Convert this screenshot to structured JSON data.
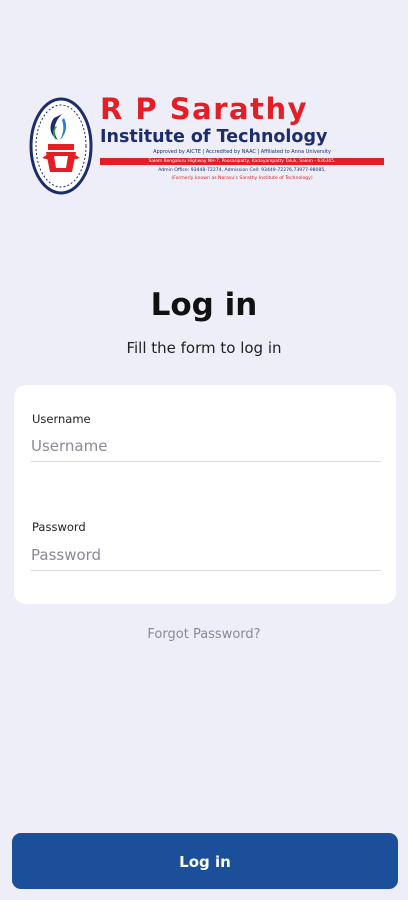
{
  "logo": {
    "name": "R P Sarathy",
    "subtitle": "Institute of Technology",
    "approved": "Approved by AICTE | Accredited by NAAC | Affiliated to Anna University",
    "address": "Salem Bengaluru Highway NH-7, Poosaripatty, Kadayampatty Taluk, Salem - 636305.",
    "contact": "Admin Office: 93448-72274, Admission Cell: 93449-72276,73977-98085,",
    "formerly": "(Formerly known as Narasu's Sarathy Institute of Technology)",
    "colors": {
      "red": "#e31e24",
      "navy": "#1d2d6b"
    }
  },
  "header": {
    "title": "Log in",
    "subtitle": "Fill the form to log in"
  },
  "form": {
    "username": {
      "label": "Username",
      "placeholder": "Username",
      "value": ""
    },
    "password": {
      "label": "Password",
      "placeholder": "Password",
      "value": ""
    }
  },
  "forgot_password": "Forgot Password?",
  "login_button": "Log in",
  "colors": {
    "background": "#eeeef8",
    "card": "#ffffff",
    "primary": "#1c4f99",
    "muted_text": "#8a8a96"
  }
}
